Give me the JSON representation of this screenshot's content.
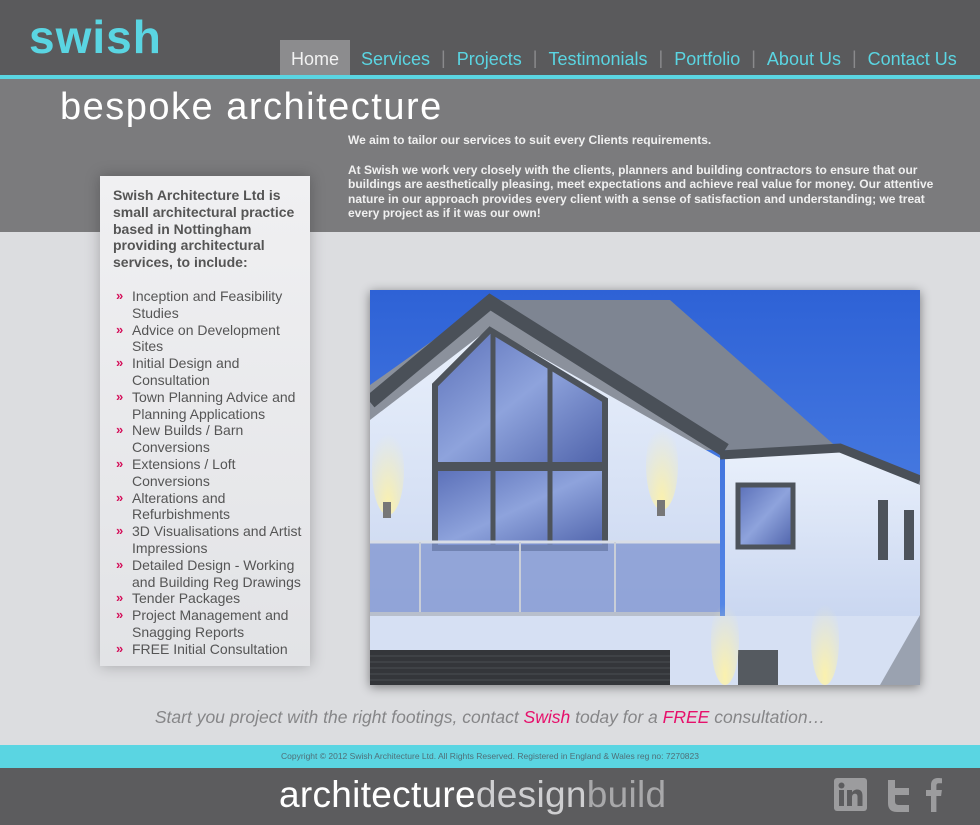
{
  "logo": "swish",
  "nav": [
    {
      "label": "Home",
      "active": true
    },
    {
      "label": "Services"
    },
    {
      "label": "Projects"
    },
    {
      "label": "Testimonials"
    },
    {
      "label": "Portfolio"
    },
    {
      "label": "About Us"
    },
    {
      "label": "Contact Us"
    }
  ],
  "banner": {
    "tagline": "bespoke  architecture",
    "intro_1": "We aim to tailor our services to suit every Clients requirements.",
    "intro_2": "At Swish we work very closely with the clients, planners and building contractors to ensure that our buildings are aesthetically pleasing, meet expectations and achieve real value for money. Our attentive nature in our approach provides every client with a sense of satisfaction and understanding; we treat every project as if it was our own!"
  },
  "sidebar": {
    "intro": "Swish Architecture Ltd is small architectural practice based in Nottingham providing architectural services, to include:",
    "bullet": "»",
    "services": [
      "Inception and Feasibility Studies",
      "Advice on Development Sites",
      "Initial Design and Consultation",
      "Town Planning Advice and Planning Applications",
      "New Builds / Barn Conversions",
      "Extensions / Loft Conversions",
      "Alterations and Refurbishments",
      "3D Visualisations and Artist Impressions",
      "Detailed Design - Working and Building Reg Drawings",
      "Tender Packages",
      "Project Management and Snagging Reports",
      "FREE Initial Consultation"
    ]
  },
  "cta": {
    "part1": "Start you project with the right footings, contact ",
    "brand": "Swish",
    "part2": " today for a ",
    "free": "FREE",
    "part3": " consultation…"
  },
  "footer": {
    "copyright": "Copyright © 2012 Swish Architecture Ltd. All Rights Reserved. Registered in England & Wales reg no: 7270823",
    "tag_a": "architecture",
    "tag_b": "design",
    "tag_c": "build",
    "social": [
      "linkedin-icon",
      "twitter-icon",
      "facebook-icon"
    ]
  },
  "colors": {
    "accent": "#5ad5e2",
    "header": "#5a5a5c",
    "banner": "#7b7b7d",
    "highlight": "#e6106b"
  }
}
